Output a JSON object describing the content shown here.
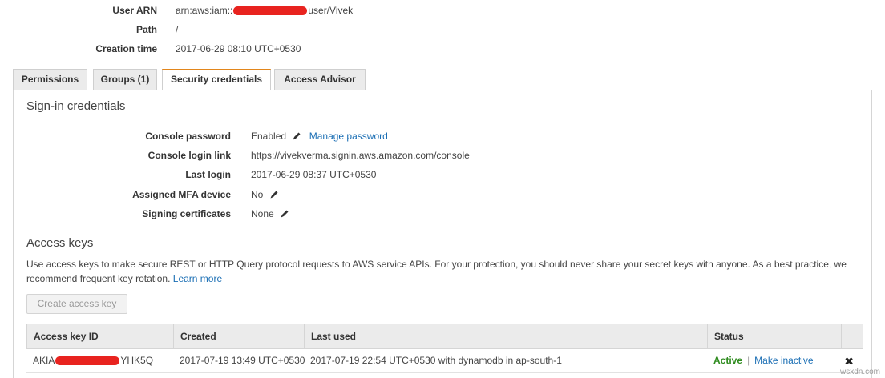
{
  "summary": {
    "arn_label": "User ARN",
    "arn_prefix": "arn:aws:iam::",
    "arn_suffix": "user/Vivek",
    "path_label": "Path",
    "path_value": "/",
    "created_label": "Creation time",
    "created_value": "2017-06-29 08:10 UTC+0530"
  },
  "tabs": [
    {
      "label": "Permissions"
    },
    {
      "label": "Groups (1)"
    },
    {
      "label": "Security credentials"
    },
    {
      "label": "Access Advisor"
    }
  ],
  "active_tab": "Security credentials",
  "signin": {
    "title": "Sign-in credentials",
    "rows": [
      {
        "label": "Console password",
        "value": "Enabled",
        "link": "Manage password"
      },
      {
        "label": "Console login link",
        "value": "https://vivekverma.signin.aws.amazon.com/console"
      },
      {
        "label": "Last login",
        "value": "2017-06-29 08:37 UTC+0530"
      },
      {
        "label": "Assigned MFA device",
        "value": "No"
      },
      {
        "label": "Signing certificates",
        "value": "None"
      }
    ]
  },
  "access_keys": {
    "title": "Access keys",
    "description": "Use access keys to make secure REST or HTTP Query protocol requests to AWS service APIs. For your protection, you should never share your secret keys with anyone. As a best practice, we recommend frequent key rotation.",
    "learn_more": "Learn more",
    "create_button": "Create access key",
    "columns": [
      "Access key ID",
      "Created",
      "Last used",
      "Status"
    ],
    "row": {
      "key_prefix": "AKIA",
      "key_suffix": "YHK5Q",
      "created": "2017-07-19 13:49 UTC+0530",
      "last_used": "2017-07-19 22:54 UTC+0530 with dynamodb in ap-south-1",
      "status": "Active",
      "action": "Make inactive",
      "separator": "|",
      "delete_glyph": "✖"
    }
  },
  "watermark": "wsxdn.com",
  "colors": {
    "accent_tab": "#e2861c",
    "link": "#1a6eb4",
    "active_status": "#2e8b1e",
    "redaction": "#e8231f"
  },
  "icons": {
    "edit": "pencil-icon",
    "delete": "close-icon"
  }
}
